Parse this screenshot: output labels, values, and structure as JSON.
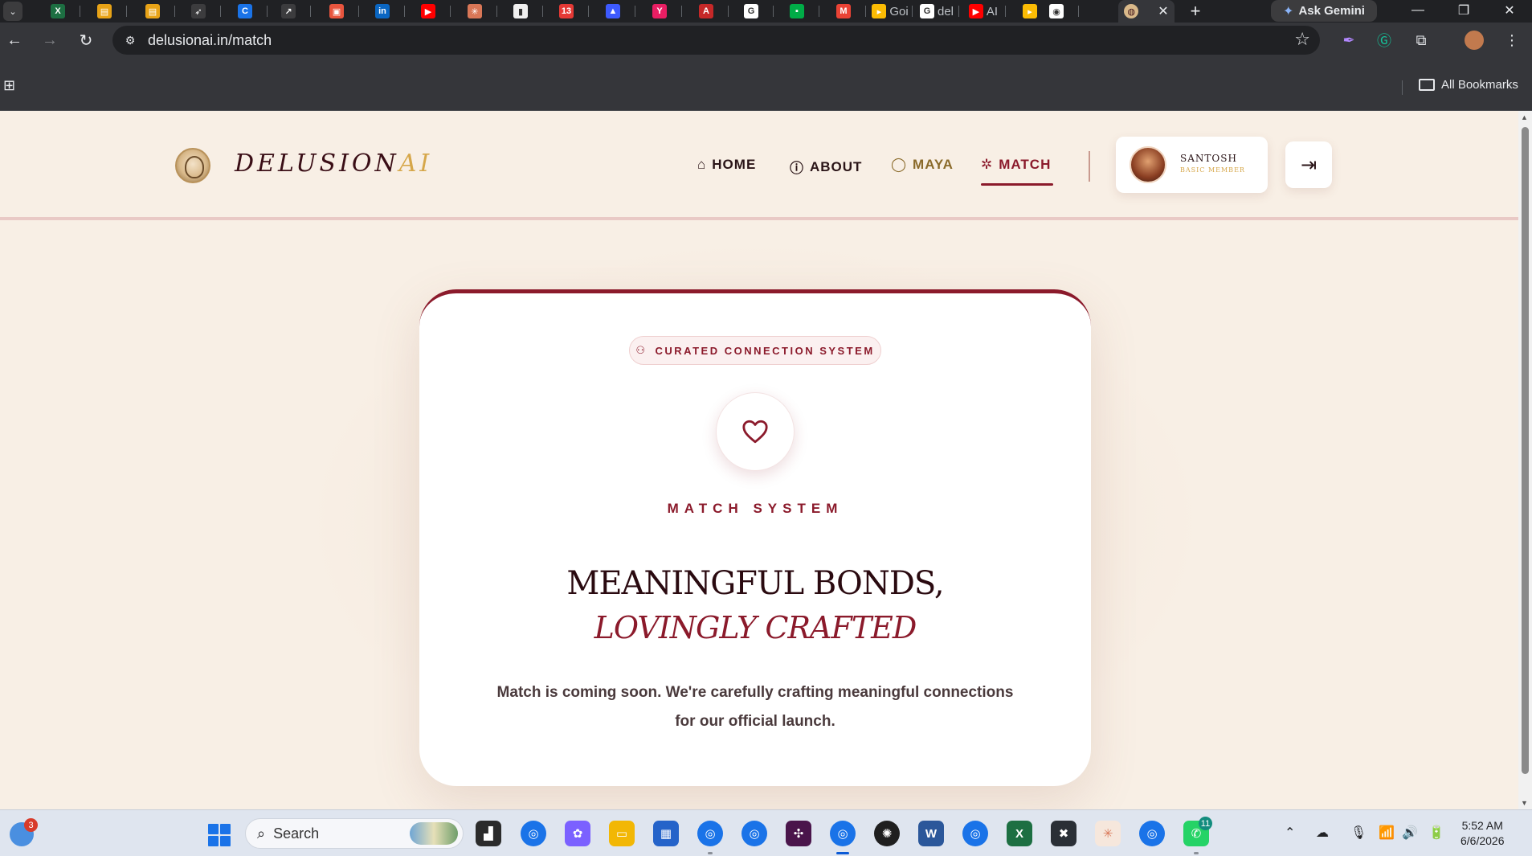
{
  "browser": {
    "tabs": [
      {
        "icon": "excel-icon",
        "color": "#1d6f42",
        "glyph": "X",
        "label": ""
      },
      {
        "icon": "slides-icon",
        "color": "#e8a317",
        "glyph": "▤",
        "label": ""
      },
      {
        "icon": "slides-icon",
        "color": "#e8a317",
        "glyph": "▤",
        "label": ""
      },
      {
        "icon": "rocket-icon",
        "color": "#3c3c3e",
        "glyph": "➶",
        "label": ""
      },
      {
        "icon": "circle-c-icon",
        "color": "#1a73e8",
        "glyph": "C",
        "label": ""
      },
      {
        "icon": "arrow-icon",
        "color": "#3c3c3e",
        "glyph": "↗",
        "label": ""
      },
      {
        "icon": "tracker-icon",
        "color": "#e8553e",
        "glyph": "▣",
        "label": ""
      },
      {
        "icon": "linkedin-icon",
        "color": "#0a66c2",
        "glyph": "in",
        "label": ""
      },
      {
        "icon": "youtube-icon",
        "color": "#ff0000",
        "glyph": "▶",
        "label": ""
      },
      {
        "icon": "sparkle-icon",
        "color": "#d97757",
        "glyph": "✳",
        "label": ""
      },
      {
        "icon": "app-icon",
        "color": "#f0f0f0",
        "glyph": "▮",
        "label": ""
      },
      {
        "icon": "badge-13-icon",
        "color": "#e53935",
        "glyph": "13",
        "label": ""
      },
      {
        "icon": "triangle-icon",
        "color": "#3d5afe",
        "glyph": "▲",
        "label": ""
      },
      {
        "icon": "y-icon",
        "color": "#e91e63",
        "glyph": "Y",
        "label": ""
      },
      {
        "icon": "a-icon",
        "color": "#c62828",
        "glyph": "A",
        "label": ""
      },
      {
        "icon": "google-icon",
        "color": "#ffffff",
        "glyph": "G",
        "label": ""
      },
      {
        "icon": "meet-icon",
        "color": "#00ac47",
        "glyph": "▪",
        "label": ""
      },
      {
        "icon": "gmail-icon",
        "color": "#ea4335",
        "glyph": "M",
        "label": ""
      },
      {
        "icon": "meet-icon",
        "color": "#fbbc04",
        "glyph": "▸",
        "label": "Goi"
      },
      {
        "icon": "google-icon",
        "color": "#ffffff",
        "glyph": "G",
        "label": "del"
      },
      {
        "icon": "youtube-icon",
        "color": "#ff0000",
        "glyph": "▶",
        "label": "AI"
      },
      {
        "icon": "meet-icon",
        "color": "#fbbc04",
        "glyph": "▸",
        "label": ""
      },
      {
        "icon": "record-icon",
        "color": "#ffffff",
        "glyph": "◉",
        "label": ""
      }
    ],
    "active_tab_label": "",
    "ask_gemini": "Ask Gemini",
    "url": "delusionai.in/match",
    "all_bookmarks": "All Bookmarks"
  },
  "site": {
    "brand_main": "DELUSION",
    "brand_accent": "AI",
    "nav": [
      {
        "icon": "home-icon",
        "label": "HOME"
      },
      {
        "icon": "info-icon",
        "label": "ABOUT"
      },
      {
        "icon": "chat-icon",
        "label": "MAYA"
      },
      {
        "icon": "sparkles-icon",
        "label": "MATCH"
      }
    ],
    "user": {
      "name": "SANTOSH",
      "tier": "BASIC MEMBER"
    }
  },
  "card": {
    "pill": "CURATED CONNECTION SYSTEM",
    "eyebrow": "MATCH SYSTEM",
    "headline_1": "MEANINGFUL BONDS,",
    "headline_2": "LOVINGLY CRAFTED",
    "description": "Match is coming soon. We're carefully crafting meaningful connections for our official launch."
  },
  "taskbar": {
    "widget_badge": "3",
    "search_placeholder": "Search",
    "whatsapp_badge": "11",
    "time": "5:52 AM",
    "date": "6/6/2026"
  },
  "colors": {
    "accent": "#8b1a2b",
    "gold": "#d6a74a",
    "page_bg": "#f8efe5"
  }
}
